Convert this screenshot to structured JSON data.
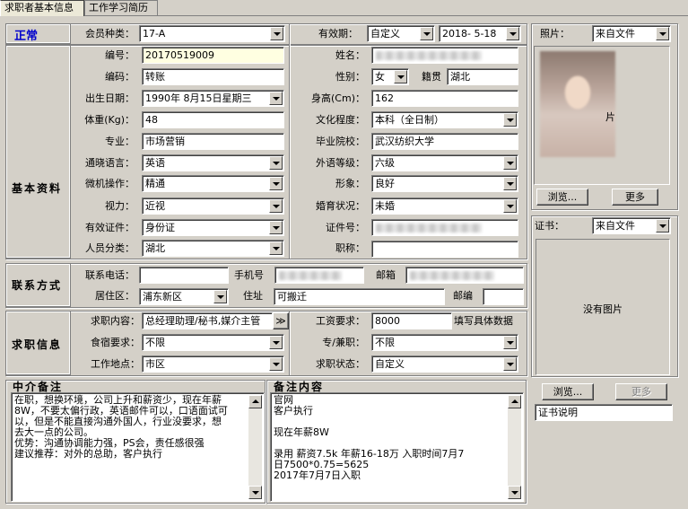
{
  "tabs": [
    {
      "label": "求职者基本信息",
      "active": true
    },
    {
      "label": "工作学习简历",
      "active": false
    }
  ],
  "status": {
    "text": "正常",
    "color": "#0000cc"
  },
  "membership": {
    "type_label": "会员种类：",
    "type_value": "17-A",
    "validity_label": "有效期：",
    "validity_mode": "自定义",
    "validity_date": "2018- 5-18"
  },
  "basic": {
    "section_title": "基本资料",
    "id_label": "编号：",
    "id_value": "20170519009",
    "name_label": "姓名：",
    "code_label": "编码：",
    "code_value": "转账",
    "gender_label": "性别：",
    "gender_value": "女",
    "native_label": "籍贯",
    "native_value": "湖北",
    "birth_label": "出生日期：",
    "birth_value": "1990年 8月15日星期三",
    "height_label": "身高(Cm)：",
    "height_value": "162",
    "weight_label": "体重(Kg)：",
    "weight_value": "48",
    "education_label": "文化程度：",
    "education_value": "本科（全日制）",
    "major_label": "专业：",
    "major_value": "市场营销",
    "school_label": "毕业院校：",
    "school_value": "武汉纺织大学",
    "language_label": "通晓语言：",
    "language_value": "英语",
    "lang_level_label": "外语等级：",
    "lang_level_value": "六级",
    "computer_label": "微机操作：",
    "computer_value": "精通",
    "image_label": "形象：",
    "image_value": "良好",
    "vision_label": "视力：",
    "vision_value": "近视",
    "marital_label": "婚育状况：",
    "marital_value": "未婚",
    "cert_type_label": "有效证件：",
    "cert_type_value": "身份证",
    "cert_no_label": "证件号：",
    "category_label": "人员分类：",
    "category_value": "湖北",
    "title_label": "职称：",
    "title_value": ""
  },
  "contact": {
    "section_title": "联系方式",
    "phone_label": "联系电话：",
    "phone_value": "",
    "mobile_label": "手机号",
    "email_label": "邮箱",
    "district_label": "居住区：",
    "district_value": "浦东新区",
    "address_label": "住址",
    "address_value": "可搬迁",
    "zip_label": "邮编",
    "zip_value": ""
  },
  "job": {
    "section_title": "求职信息",
    "content_label": "求职内容：",
    "content_value": "总经理助理/秘书,媒介主管",
    "more_button": "≫",
    "salary_label": "工资要求：",
    "salary_value": "8000",
    "salary_hint": "填写具体数据",
    "board_label": "食宿要求：",
    "board_value": "不限",
    "parttime_label": "专/兼职：",
    "parttime_value": "不限",
    "location_label": "工作地点：",
    "location_value": "市区",
    "status_label": "求职状态：",
    "status_value": "自定义"
  },
  "agency_notes": {
    "title": "中介备注",
    "lines": [
      "在职，想换环境，公司上升和薪资少，现在年薪",
      "8W，不要太偏行政，英语邮件可以，口语面试可",
      "以，但是不能直接沟通外国人，行业没要求，想",
      "去大一点的公司。",
      "优势：沟通协调能力强，PS会，责任感很强",
      "建议推荐：对外的总助，客户执行"
    ]
  },
  "remarks": {
    "title": "备注内容",
    "lines": [
      "官网",
      "客户执行",
      "",
      "现在年薪8W",
      "",
      "录用 薪资7.5k 年薪16-18万 入职时间7月7",
      "日7500*0.75=5625",
      "2017年7月7日入职"
    ]
  },
  "photo": {
    "label": "照片：",
    "source": "来自文件",
    "overlay_text": "片",
    "browse_button": "浏览...",
    "more_button": "更多"
  },
  "certificate": {
    "label": "证书：",
    "source": "来自文件",
    "empty_text": "没有图片",
    "browse_button": "浏览...",
    "more_button": "更多",
    "description": "证书说明"
  }
}
